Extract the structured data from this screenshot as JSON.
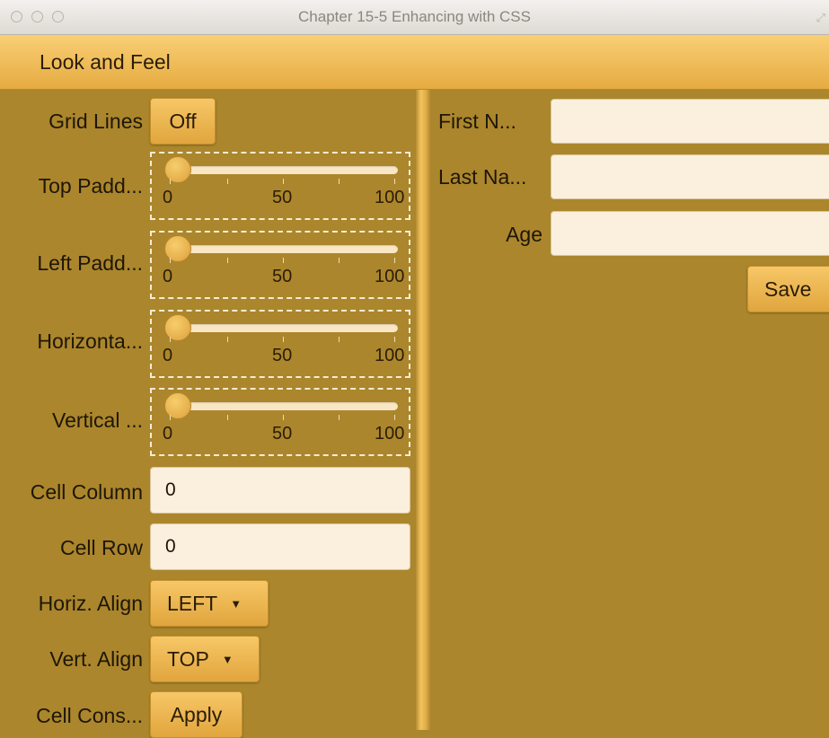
{
  "window": {
    "title": "Chapter 15-5 Enhancing with CSS"
  },
  "menu": {
    "items": [
      "Look and Feel"
    ]
  },
  "colors": {
    "background": "#ab862c",
    "accent": "#f0bb55",
    "field": "#fbf0dd",
    "menubar": "#f3c25e"
  },
  "left": {
    "grid_lines": {
      "label": "Grid Lines",
      "value": "Off"
    },
    "sliders": [
      {
        "label": "Top Padd...",
        "value": 0,
        "min": 0,
        "max": 100,
        "ticks": [
          "0",
          "50",
          "100"
        ]
      },
      {
        "label": "Left Padd...",
        "value": 0,
        "min": 0,
        "max": 100,
        "ticks": [
          "0",
          "50",
          "100"
        ]
      },
      {
        "label": "Horizonta...",
        "value": 0,
        "min": 0,
        "max": 100,
        "ticks": [
          "0",
          "50",
          "100"
        ]
      },
      {
        "label": "Vertical ...",
        "value": 0,
        "min": 0,
        "max": 100,
        "ticks": [
          "0",
          "50",
          "100"
        ]
      }
    ],
    "cell_column": {
      "label": "Cell Column",
      "value": "0"
    },
    "cell_row": {
      "label": "Cell Row",
      "value": "0"
    },
    "horiz_align": {
      "label": "Horiz. Align",
      "value": "LEFT"
    },
    "vert_align": {
      "label": "Vert. Align",
      "value": "TOP"
    },
    "cell_cons": {
      "label": "Cell Cons...",
      "button": "Apply"
    }
  },
  "right": {
    "first_name": {
      "label": "First N...",
      "value": ""
    },
    "last_name": {
      "label": "Last Na...",
      "value": ""
    },
    "age": {
      "label": "Age",
      "value": ""
    },
    "save_label": "Save"
  }
}
